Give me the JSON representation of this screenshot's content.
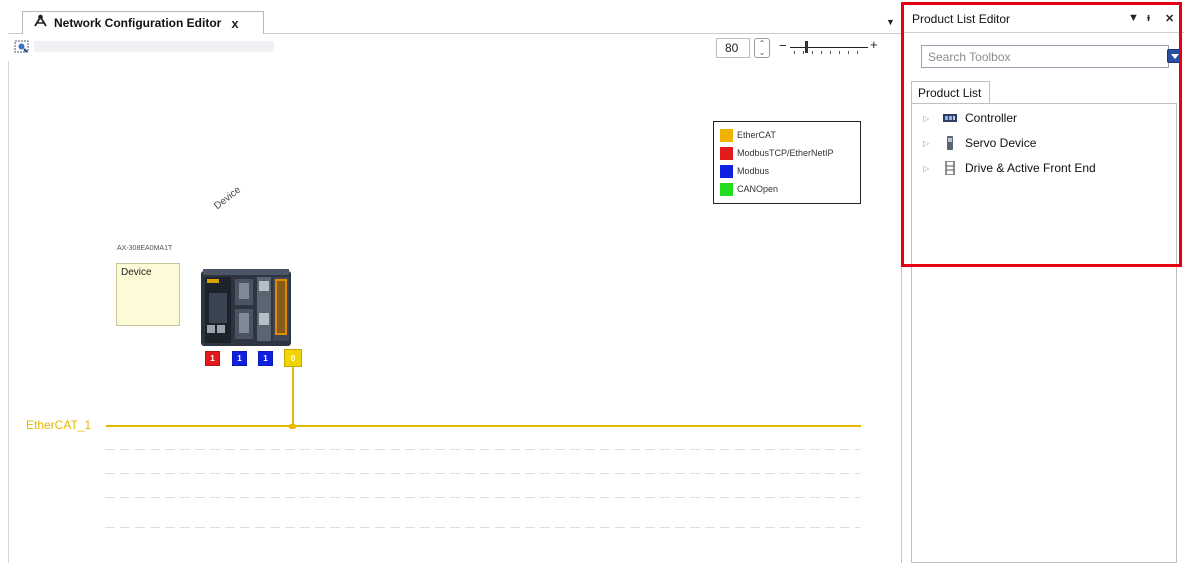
{
  "editor": {
    "tab_title": "Network Configuration Editor",
    "tab_close": "x",
    "menu_glyph": "▼",
    "zoom_value": "80",
    "zoom_level_percent": 80,
    "zoom_minus": "−",
    "zoom_plus": "+"
  },
  "legend": {
    "items": [
      {
        "label": "EtherCAT",
        "color": "#f0b400"
      },
      {
        "label": "ModbusTCP/EtherNetIP",
        "color": "#e31a1c"
      },
      {
        "label": "Modbus",
        "color": "#1020e0"
      },
      {
        "label": "CANOpen",
        "color": "#22dd22"
      }
    ]
  },
  "device": {
    "rotated_label": "Device",
    "model": "AX-308EA0MA1T",
    "name": "Device",
    "ports": [
      {
        "value": "1",
        "color": "#e31a1c"
      },
      {
        "value": "1",
        "color": "#1020e0"
      },
      {
        "value": "1",
        "color": "#1020e0"
      },
      {
        "value": "0",
        "color": "#f2d400"
      }
    ]
  },
  "bus": {
    "label": "EtherCAT_1",
    "color": "#e6b800"
  },
  "panel": {
    "title": "Product List Editor",
    "btn_menu": "▼",
    "btn_pin": "ᵻ",
    "btn_close": "✕",
    "search_placeholder": "Search Toolbox",
    "tab_label": "Product List",
    "tree": [
      {
        "label": "Controller",
        "icon": "controller-icon"
      },
      {
        "label": "Servo Device",
        "icon": "servo-icon"
      },
      {
        "label": "Drive & Active Front End",
        "icon": "drive-icon"
      }
    ]
  },
  "highlight_color": "#e60012"
}
